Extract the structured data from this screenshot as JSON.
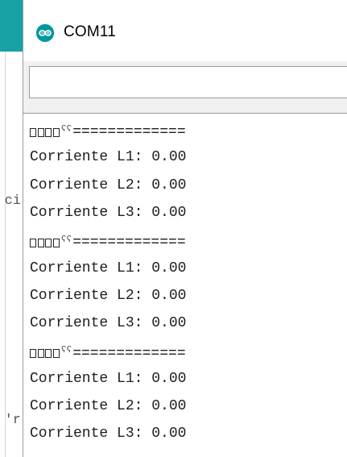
{
  "background_ide": {
    "fragment_1": "ci",
    "fragment_2": "'r"
  },
  "window": {
    "title": "COM11",
    "icon": "arduino-infinity-icon",
    "input_value": ""
  },
  "output_lines": [
    {
      "type": "separator",
      "prefix_glyphs": "□□□□",
      "tail": "============="
    },
    {
      "type": "text",
      "text": "Corriente L1: 0.00"
    },
    {
      "type": "text",
      "text": "Corriente L2: 0.00"
    },
    {
      "type": "text",
      "text": "Corriente L3: 0.00"
    },
    {
      "type": "separator",
      "prefix_glyphs": "□□□□",
      "tail": "============="
    },
    {
      "type": "text",
      "text": "Corriente L1: 0.00"
    },
    {
      "type": "text",
      "text": "Corriente L2: 0.00"
    },
    {
      "type": "text",
      "text": "Corriente L3: 0.00"
    },
    {
      "type": "separator",
      "prefix_glyphs": "□□□□",
      "tail": "============="
    },
    {
      "type": "text",
      "text": "Corriente L1: 0.00"
    },
    {
      "type": "text",
      "text": "Corriente L2: 0.00"
    },
    {
      "type": "text",
      "text": "Corriente L3: 0.00"
    }
  ],
  "colors": {
    "arduino_teal": "#00979c",
    "ide_header": "#17a1a5"
  }
}
